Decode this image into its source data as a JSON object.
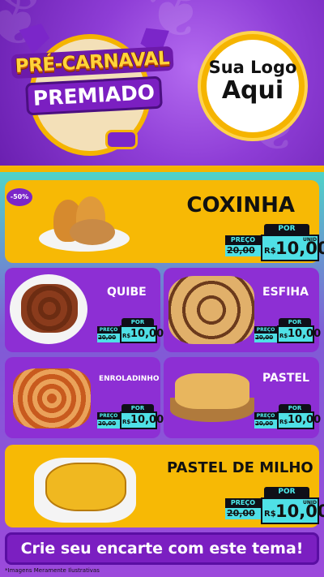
{
  "header": {
    "title_line1": "PRÉ-CARNAVAL",
    "title_line2": "PREMIADO",
    "logo_line1": "Sua Logo",
    "logo_line2": "Aqui"
  },
  "featured": {
    "discount": "-50%",
    "name": "COXINHA",
    "por": "POR",
    "preco": "PREÇO",
    "old_price": "20,00",
    "currency": "R$",
    "price": "10,00",
    "unit": "UNID"
  },
  "items": [
    {
      "name": "QUIBE",
      "por": "POR",
      "preco": "PREÇO",
      "old_price": "20,00",
      "currency": "R$",
      "price": "10,00",
      "unit": "UNID"
    },
    {
      "name": "ESFIHA",
      "por": "POR",
      "preco": "PREÇO",
      "old_price": "20,00",
      "currency": "R$",
      "price": "10,00",
      "unit": "UNID"
    },
    {
      "name": "ENROLADINHO",
      "por": "POR",
      "preco": "PREÇO",
      "old_price": "20,00",
      "currency": "R$",
      "price": "10,00",
      "unit": "UNID"
    },
    {
      "name": "PASTEL",
      "por": "POR",
      "preco": "PREÇO",
      "old_price": "20,00",
      "currency": "R$",
      "price": "10,00",
      "unit": "UNID"
    }
  ],
  "bottom_item": {
    "name": "PASTEL DE MILHO",
    "por": "POR",
    "preco": "PREÇO",
    "old_price": "20,00",
    "currency": "R$",
    "price": "10,00",
    "unit": "UNID"
  },
  "footer": {
    "cta": "Crie seu encarte com este tema!",
    "disclaimer": "*Imagens Meramente Ilustrativas"
  },
  "colors": {
    "purple": "#8d2fd4",
    "yellow": "#f7b905",
    "cyan": "#4fe0e6",
    "dark": "#0f0f18"
  }
}
